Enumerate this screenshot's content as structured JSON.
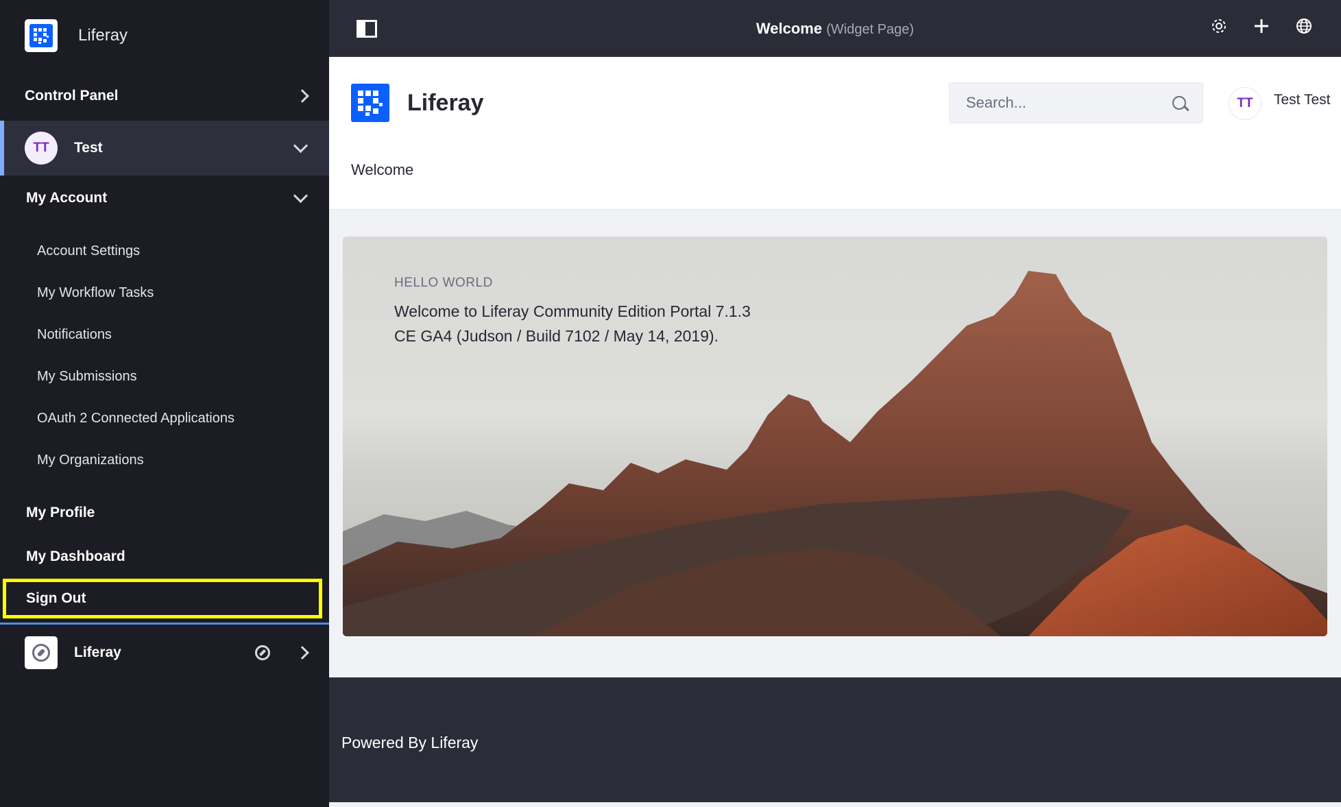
{
  "sidebar": {
    "app_title": "Liferay",
    "control_panel": "Control Panel",
    "user": {
      "initials": "TT",
      "name": "Test"
    },
    "my_account": "My Account",
    "account_items": [
      "Account Settings",
      "My Workflow Tasks",
      "Notifications",
      "My Submissions",
      "OAuth 2 Connected Applications",
      "My Organizations"
    ],
    "my_profile": "My Profile",
    "my_dashboard": "My Dashboard",
    "sign_out": "Sign Out",
    "site": {
      "name": "Liferay"
    }
  },
  "topbar": {
    "page_title": "Welcome",
    "page_type": "(Widget Page)",
    "icons": [
      "gear-icon",
      "plus-icon",
      "globe-icon"
    ]
  },
  "header": {
    "brand": "Liferay",
    "search": {
      "placeholder": "Search..."
    },
    "user": {
      "initials": "TT",
      "name": "Test Test"
    },
    "nav": [
      "Welcome"
    ]
  },
  "hero": {
    "eyebrow": "HELLO WORLD",
    "lead": "Welcome to Liferay Community Edition Portal 7.1.3 CE GA4 (Judson / Build 7102 / May 14, 2019)."
  },
  "footer": {
    "text": "Powered By Liferay"
  },
  "colors": {
    "sidebar_bg": "#1c1c24",
    "topbar_bg": "#2b2c38",
    "accent": "#0b5fff",
    "highlight": "#ffff00",
    "avatar_text": "#7a29c6"
  }
}
